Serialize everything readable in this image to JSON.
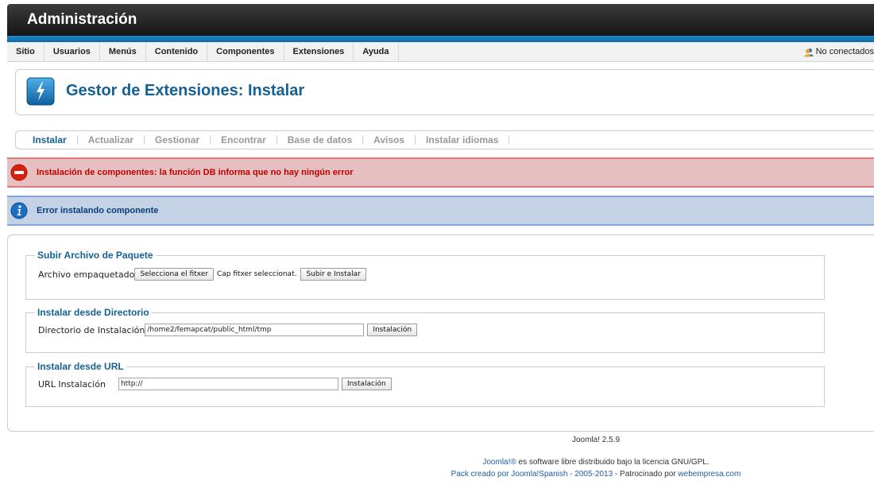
{
  "header": {
    "title": "Administración"
  },
  "menu": {
    "items": [
      "Sitio",
      "Usuarios",
      "Menús",
      "Contenido",
      "Componentes",
      "Extensiones",
      "Ayuda"
    ],
    "status": "No conectados"
  },
  "page": {
    "title": "Gestor de Extensiones: Instalar"
  },
  "submenu": {
    "items": [
      "Instalar",
      "Actualizar",
      "Gestionar",
      "Encontrar",
      "Base de datos",
      "Avisos",
      "Instalar idiomas"
    ],
    "active": "Instalar"
  },
  "messages": {
    "error": "Instalación de componentes: la función DB informa que no hay ningún error",
    "info": "Error instalando componente"
  },
  "upload": {
    "legend": "Subir Archivo de Paquete",
    "label": "Archivo empaquetado",
    "file_button": "Selecciona el fitxer",
    "file_status": "Cap fitxer seleccionat.",
    "submit": "Subir e Instalar"
  },
  "directory": {
    "legend": "Instalar desde Directorio",
    "label": "Directorio de Instalación",
    "value": "/home2/femapcat/public_html/tmp",
    "submit": "Instalación"
  },
  "url": {
    "legend": "Instalar desde URL",
    "label": "URL Instalación",
    "value": "http://",
    "submit": "Instalación"
  },
  "footer": {
    "version": "Joomla! 2.5.9",
    "joomla_link": "Joomla!®",
    "license_text": " es software libre distribuido bajo la licencia GNU/GPL.",
    "pack_link": "Pack creado por Joomla!Spanish - 2005-2013",
    "sponsor_text": " - Patrocinado por ",
    "sponsor_link": "webempresa.com"
  },
  "colors": {
    "brand_blue": "#146295",
    "error_bg": "#e6c0c0",
    "info_bg": "#c3d2e5"
  }
}
